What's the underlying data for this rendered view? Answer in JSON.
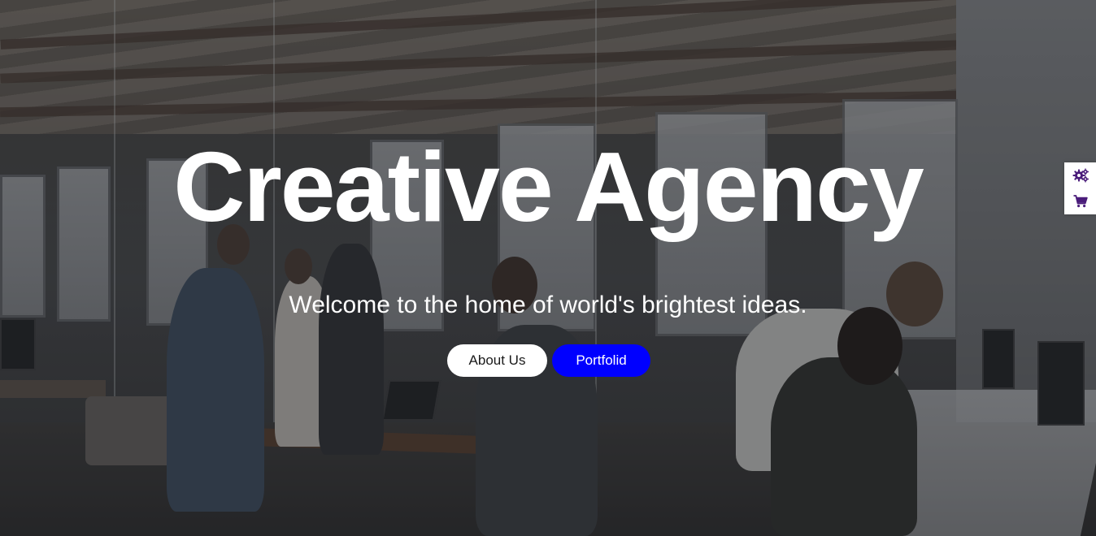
{
  "hero": {
    "title": "Creative Agency",
    "subtitle": "Welcome to the home of world's brightest ideas.",
    "buttons": {
      "about_label": "About Us",
      "portfolio_label": "Portfolid"
    }
  },
  "side_widget": {
    "items": [
      {
        "icon": "gears-icon"
      },
      {
        "icon": "shopping-cart-icon"
      }
    ]
  },
  "colors": {
    "primary_button": "#0000ff",
    "secondary_button": "#ffffff",
    "widget_icon": "#4a1c7a",
    "overlay": "#1e2024"
  }
}
